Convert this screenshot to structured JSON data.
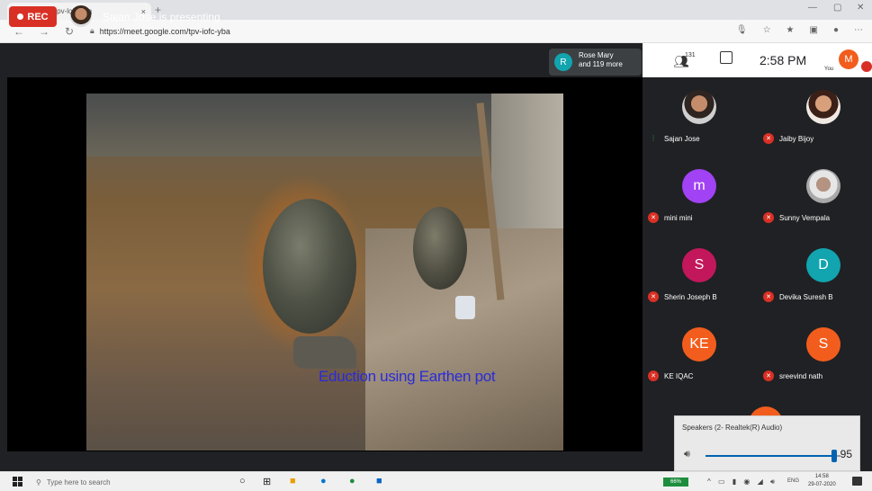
{
  "browser": {
    "tab_title": "Meet - tpv-lofc-yba",
    "tab_close": "×",
    "new_tab": "+",
    "url": "https://meet.google.com/tpv-iofc-yba",
    "window_controls": [
      "—",
      "▢",
      "✕"
    ]
  },
  "meet": {
    "rec_label": "REC",
    "presenting_text": "Sajan Jose is presenting",
    "others_initial": "R",
    "others_line1": "Rose Mary",
    "others_line2": "and 119 more",
    "people_count": "131",
    "clock": "2:58 PM",
    "you_initial": "M",
    "you_label": "You"
  },
  "slide": {
    "caption": "Eduction using Earthen pot"
  },
  "participants": [
    {
      "name": "Sajan Jose",
      "avatar": "photo",
      "initial": "",
      "color": "",
      "state": "speaking"
    },
    {
      "name": "Jaiby Bijoy",
      "avatar": "photo2",
      "initial": "",
      "color": "",
      "state": "muted"
    },
    {
      "name": "mini mini",
      "avatar": "letter",
      "initial": "m",
      "color": "#a142f4",
      "state": "muted"
    },
    {
      "name": "Sunny Vempala",
      "avatar": "photo3",
      "initial": "",
      "color": "",
      "state": "muted"
    },
    {
      "name": "Sherin Joseph B",
      "avatar": "letter",
      "initial": "S",
      "color": "#c2185b",
      "state": "muted"
    },
    {
      "name": "Devika Suresh B",
      "avatar": "letter",
      "initial": "D",
      "color": "#12a4af",
      "state": "muted"
    },
    {
      "name": "KE IQAC",
      "avatar": "letter",
      "initial": "KE",
      "color": "#f25d1d",
      "state": "muted"
    },
    {
      "name": "sreevind nath",
      "avatar": "letter",
      "initial": "S",
      "color": "#f25d1d",
      "state": "muted"
    }
  ],
  "volume": {
    "device": "Speakers (2- Realtek(R) Audio)",
    "level": 95
  },
  "taskbar": {
    "search_placeholder": "Type here to search",
    "battery": "66%",
    "lang": "ENG",
    "time": "14:58",
    "date": "29-07-2020"
  }
}
